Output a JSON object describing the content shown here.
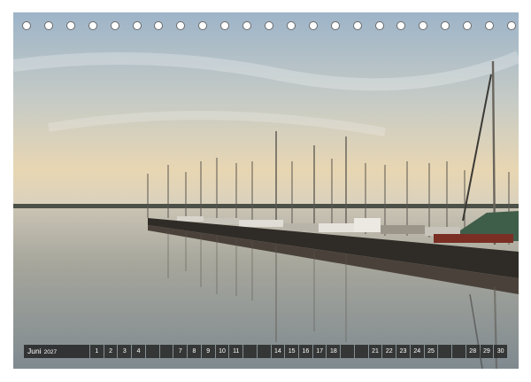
{
  "calendar": {
    "month": "Juni",
    "year": "2027",
    "days": [
      {
        "n": "1",
        "sun": false
      },
      {
        "n": "2",
        "sun": false
      },
      {
        "n": "3",
        "sun": false
      },
      {
        "n": "4",
        "sun": false
      },
      {
        "n": "",
        "sun": true
      },
      {
        "n": "",
        "sun": true
      },
      {
        "n": "7",
        "sun": false
      },
      {
        "n": "8",
        "sun": false
      },
      {
        "n": "9",
        "sun": false
      },
      {
        "n": "10",
        "sun": false
      },
      {
        "n": "11",
        "sun": false
      },
      {
        "n": "",
        "sun": true
      },
      {
        "n": "",
        "sun": true
      },
      {
        "n": "14",
        "sun": false
      },
      {
        "n": "15",
        "sun": false
      },
      {
        "n": "16",
        "sun": false
      },
      {
        "n": "17",
        "sun": false
      },
      {
        "n": "18",
        "sun": false
      },
      {
        "n": "",
        "sun": true
      },
      {
        "n": "",
        "sun": true
      },
      {
        "n": "21",
        "sun": false
      },
      {
        "n": "22",
        "sun": false
      },
      {
        "n": "23",
        "sun": false
      },
      {
        "n": "24",
        "sun": false
      },
      {
        "n": "25",
        "sun": false
      },
      {
        "n": "",
        "sun": true
      },
      {
        "n": "",
        "sun": true
      },
      {
        "n": "28",
        "sun": false
      },
      {
        "n": "29",
        "sun": false
      },
      {
        "n": "30",
        "sun": false
      }
    ],
    "ring_count": 23,
    "colors": {
      "bar": "#232323",
      "sunday": "#e23030",
      "text": "#ffffff"
    }
  },
  "photo": {
    "subject": "harbor-with-sailboats",
    "colors": {
      "sky_top": "#9fb6c9",
      "sky_horizon": "#e8d4ae",
      "water": "#8f9aa2",
      "pier": "#3a3530"
    }
  }
}
